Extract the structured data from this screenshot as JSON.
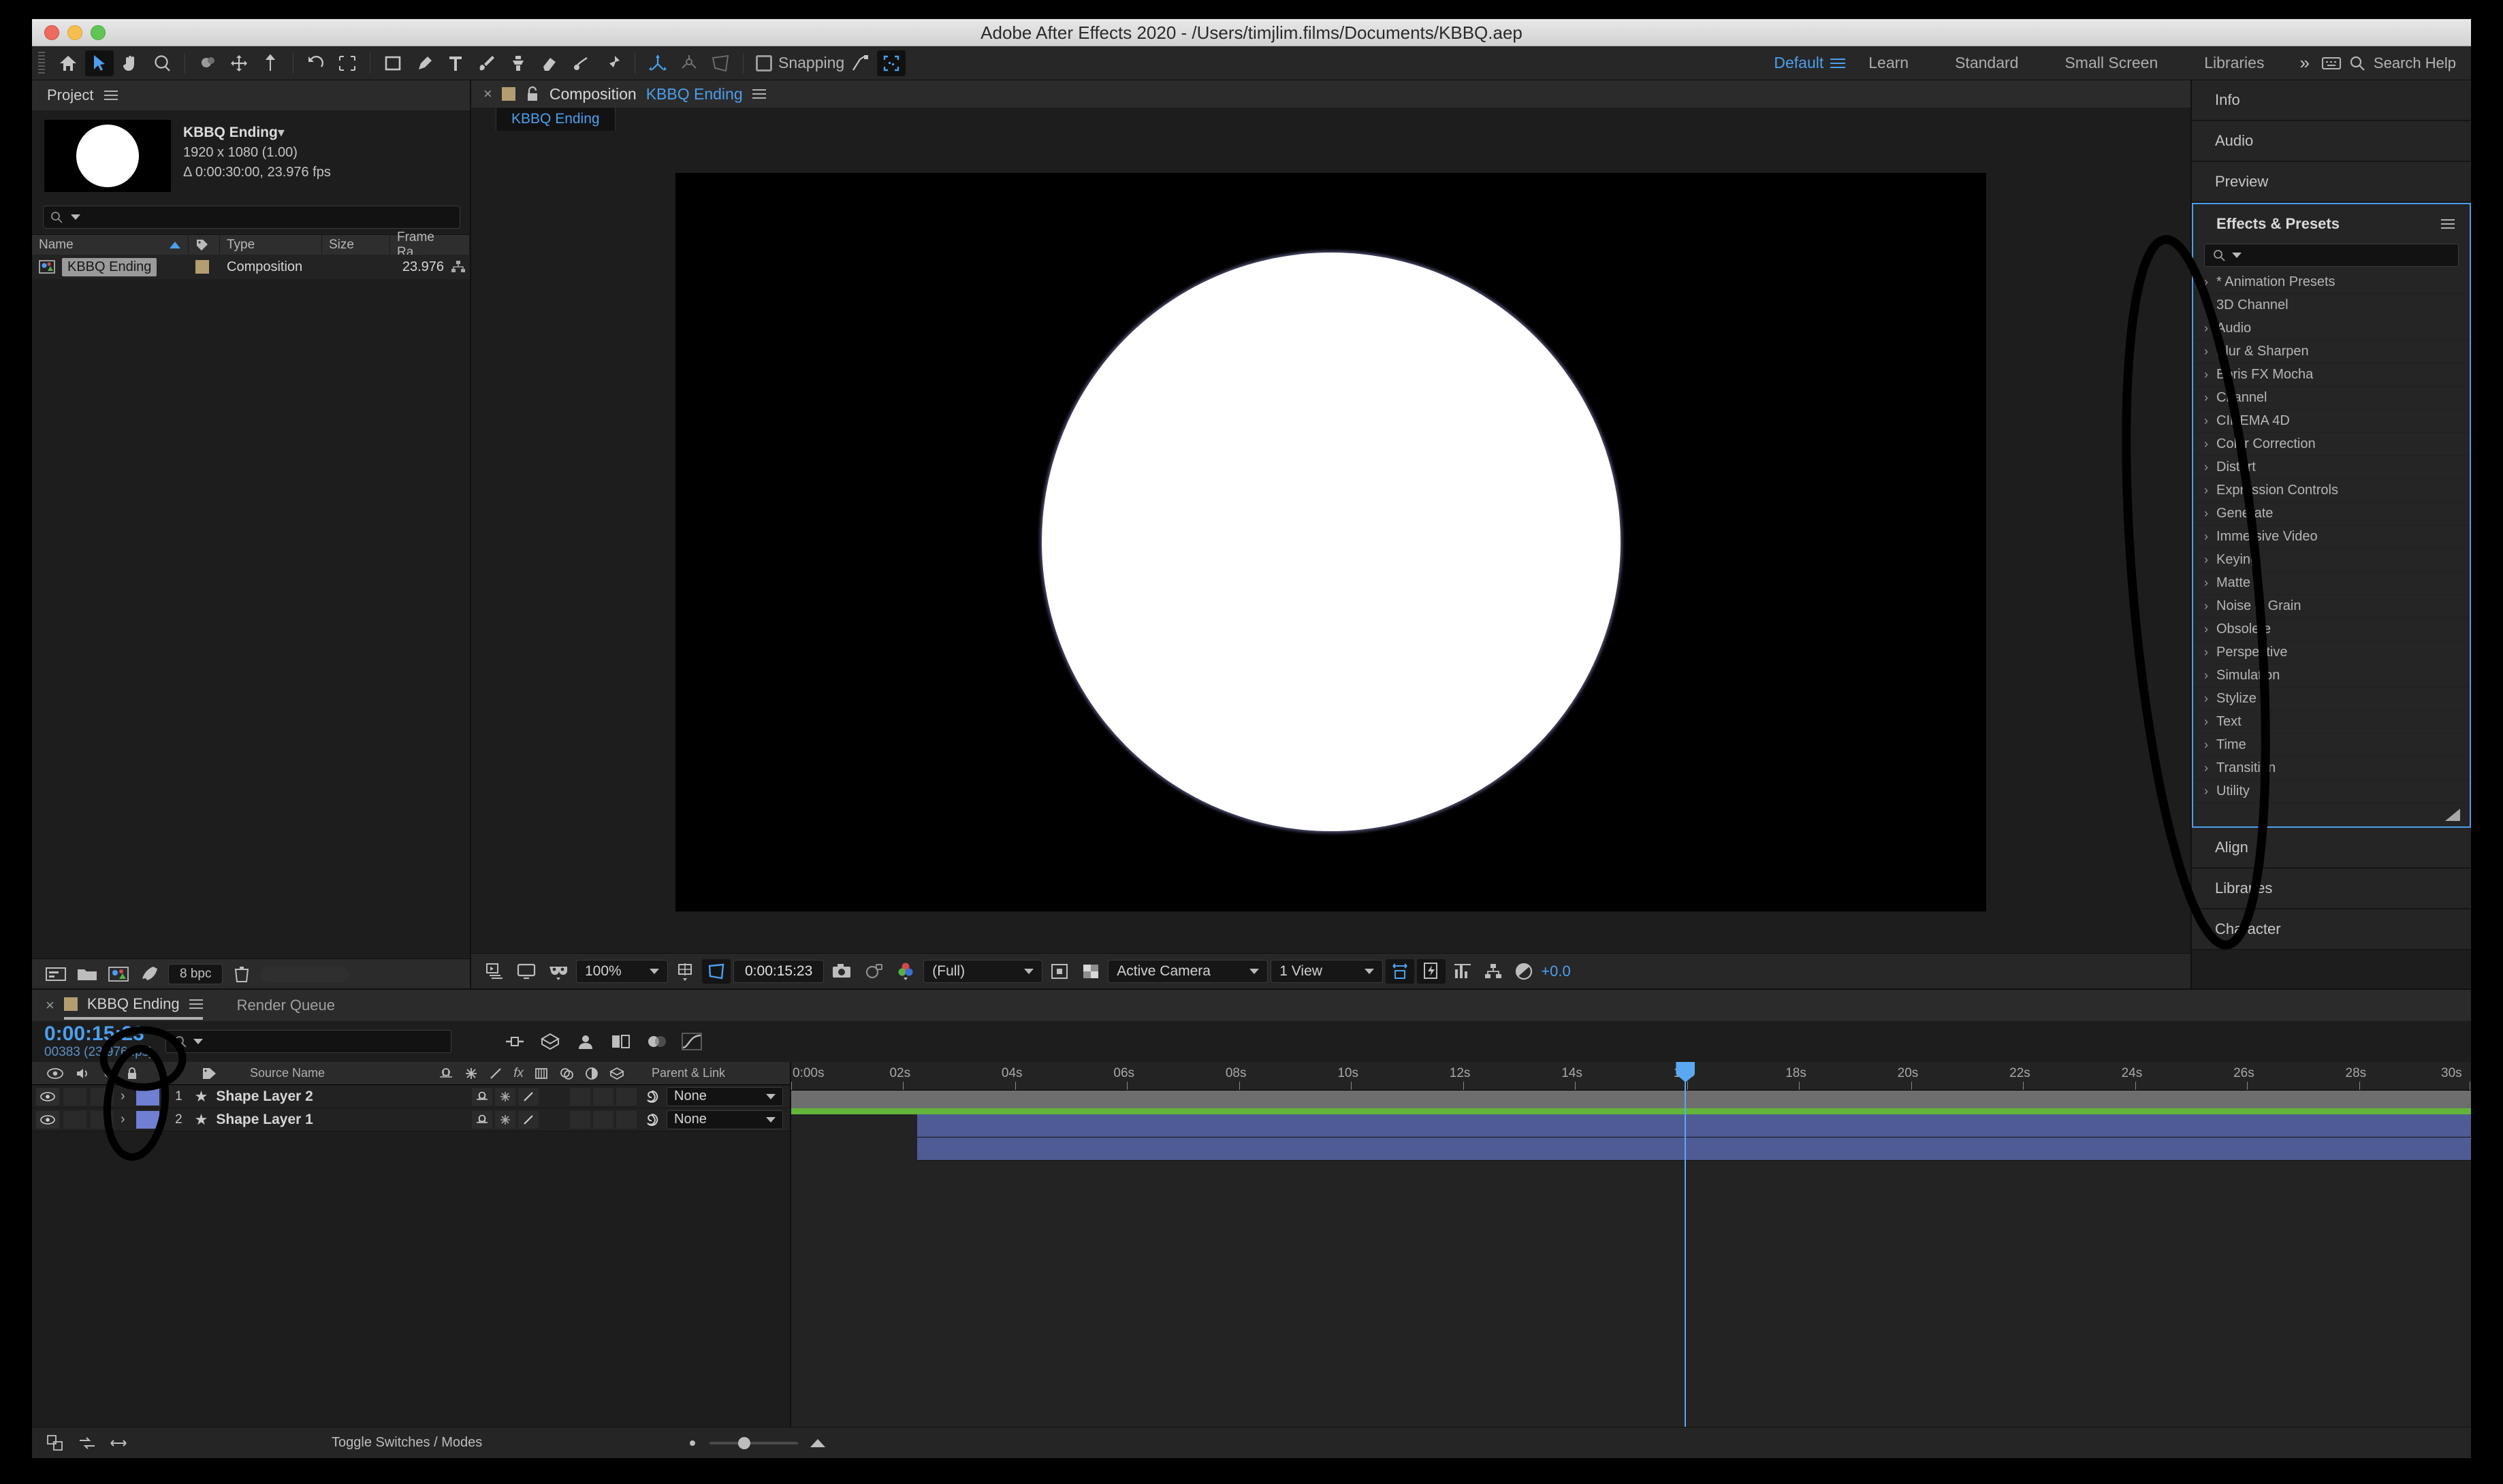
{
  "window": {
    "title": "Adobe After Effects 2020 - /Users/timjlim.films/Documents/KBBQ.aep"
  },
  "toolbar": {
    "snapping_label": "Snapping",
    "workspaces": [
      {
        "label": "Default",
        "active": true
      },
      {
        "label": "Learn",
        "active": false
      },
      {
        "label": "Standard",
        "active": false
      },
      {
        "label": "Small Screen",
        "active": false
      },
      {
        "label": "Libraries",
        "active": false
      }
    ],
    "more_chevron": "»",
    "search_help_placeholder": "Search Help"
  },
  "project_panel": {
    "title": "Project",
    "item_name": "KBBQ Ending",
    "item_name_caret": "▾",
    "resolution": "1920 x 1080 (1.00)",
    "duration": "Δ 0:00:30:00, 23.976 fps",
    "search_placeholder": "",
    "columns": [
      "Name",
      "Type",
      "Size",
      "Frame Ra..."
    ],
    "rows": [
      {
        "name": "KBBQ Ending",
        "type": "Composition",
        "size": "",
        "frame_rate": "23.976"
      }
    ],
    "bit_depth": "8 bpc"
  },
  "composition_panel": {
    "tab_prefix": "Composition",
    "tab_name": "KBBQ Ending",
    "sub_tab": "KBBQ Ending",
    "zoom": "100%",
    "timecode": "0:00:15:23",
    "resolution": "(Full)",
    "camera": "Active Camera",
    "views": "1 View",
    "exposure": "+0.0"
  },
  "right_panels": {
    "top": [
      {
        "label": "Info"
      },
      {
        "label": "Audio"
      },
      {
        "label": "Preview"
      }
    ],
    "effects": {
      "title": "Effects & Presets",
      "search_placeholder": "",
      "categories": [
        "* Animation Presets",
        "3D Channel",
        "Audio",
        "Blur & Sharpen",
        "Boris FX Mocha",
        "Channel",
        "CINEMA 4D",
        "Color Correction",
        "Distort",
        "Expression Controls",
        "Generate",
        "Immersive Video",
        "Keying",
        "Matte",
        "Noise & Grain",
        "Obsolete",
        "Perspective",
        "Simulation",
        "Stylize",
        "Text",
        "Time",
        "Transition",
        "Utility"
      ]
    },
    "bottom": [
      {
        "label": "Align"
      },
      {
        "label": "Libraries"
      },
      {
        "label": "Character"
      }
    ]
  },
  "timeline": {
    "tab_name": "KBBQ Ending",
    "render_queue_tab": "Render Queue",
    "current_time": "0:00:15:23",
    "frame_info": "00383 (23.976 fps)",
    "search_placeholder": "",
    "columns": {
      "source_name": "Source Name",
      "parent_link": "Parent & Link"
    },
    "layers": [
      {
        "index": "1",
        "name": "Shape Layer 2",
        "parent": "None",
        "label_color": "#6f7fd1"
      },
      {
        "index": "2",
        "name": "Shape Layer 1",
        "parent": "None",
        "label_color": "#6f7fd1"
      }
    ],
    "ruler_ticks": [
      "0:00s",
      "02s",
      "04s",
      "06s",
      "08s",
      "10s",
      "12s",
      "14s",
      "16s",
      "18s",
      "20s",
      "22s",
      "24s",
      "26s",
      "28s",
      "30s"
    ],
    "toggle_switches_label": "Toggle Switches / Modes"
  },
  "colors": {
    "accent_blue": "#4b9fee",
    "layer_bar": "#4f5b94",
    "work_area": "#6e6e6e",
    "green_bar": "#63b43a",
    "comp_swatch": "#b39d71"
  }
}
